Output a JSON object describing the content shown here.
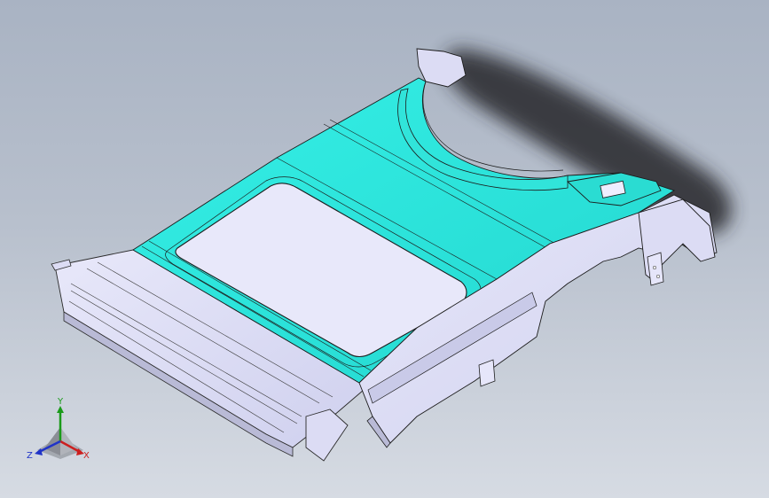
{
  "viewport": {
    "background_top": "#a9b3c3",
    "background_bottom": "#d6dbe3",
    "face_color_highlight": "#2fe8de",
    "face_color_body": "#dcdcf4",
    "edge_color": "#2a2a2a",
    "shadow_color": "#1f2124"
  },
  "triad": {
    "y_label": "Y",
    "x_label": "X",
    "z_label": "Z",
    "y_color": "#1a9a1a",
    "x_color": "#cc1f1f",
    "z_color": "#2034c8"
  }
}
